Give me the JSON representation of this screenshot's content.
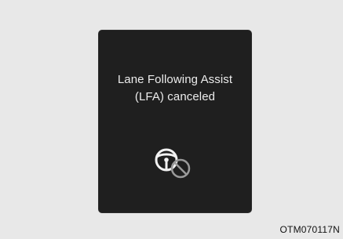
{
  "display": {
    "message_line1": "Lane Following Assist",
    "message_line2": "(LFA) canceled",
    "icon": "steering-wheel-canceled-icon"
  },
  "caption": "OTM070117N",
  "colors": {
    "background": "#e8e8e8",
    "panel": "#1f1f1f",
    "text": "#ececec",
    "icon": "#f2f2f2",
    "cancel_icon": "#9a9a9a"
  }
}
